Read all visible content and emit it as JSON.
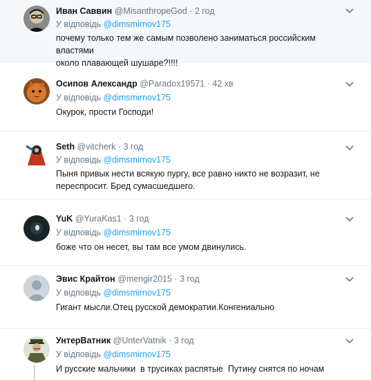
{
  "reply_prefix": "У відповідь",
  "tweets": [
    {
      "name": "Иван Саввин",
      "handle": "@MisanthropeGod",
      "sep": "·",
      "time": "2 год",
      "reply_to": "@dimsmirnov175",
      "text_lines": [
        "почему только тем же самым позволено заниматься российским властями",
        "около плавающей шушаре?!!!!"
      ]
    },
    {
      "name": "Осипов Александр",
      "handle": "@Paradox19571",
      "sep": "·",
      "time": "42 хв",
      "reply_to": "@dimsmirnov175",
      "text_lines": [
        "Окурок, прости Господи!"
      ]
    },
    {
      "name": "Seth",
      "handle": "@vitcherk",
      "sep": "·",
      "time": "3 год",
      "reply_to": "@dimsmirnov175",
      "text_lines": [
        "Пыня привык нести всякую пургу, все равно никто не возразит, не",
        "переспросит. Бред сумасшедшего."
      ]
    },
    {
      "name": "YuK",
      "handle": "@YuraKas1",
      "sep": "·",
      "time": "3 год",
      "reply_to": "@dimsmirnov175",
      "text_lines": [
        "боже что он несет, вы там все умом двинулись."
      ]
    },
    {
      "name": "Эвис Крайтон",
      "handle": "@mengir2015",
      "sep": "·",
      "time": "3 год",
      "reply_to": "@dimsmirnov175",
      "text_lines": [
        "Гигант мысли.Отец русской демократии.Конгениально"
      ]
    },
    {
      "name": "УнтерВатник",
      "handle": "@UnterVatnik",
      "sep": "·",
      "time": "3 год",
      "reply_to": "@dimsmirnov175",
      "text_lines": [
        "И русские мальчики  в трусиках распятые  Путину снятся по ночам"
      ]
    }
  ],
  "colors": {
    "link": "#1da1f2",
    "muted": "#657786",
    "divider": "#e6ecf0"
  },
  "icons": [
    "chevron-down-icon",
    "avatar"
  ]
}
